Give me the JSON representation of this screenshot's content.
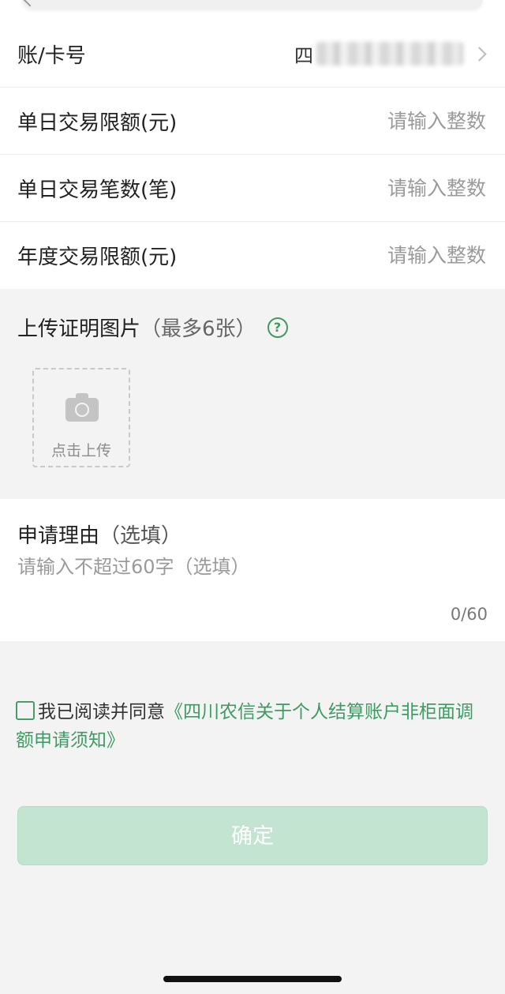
{
  "form": {
    "account": {
      "label": "账/卡号",
      "value_prefix": "四"
    },
    "daily_limit": {
      "label": "单日交易限额(元)",
      "placeholder": "请输入整数"
    },
    "daily_count": {
      "label": "单日交易笔数(笔)",
      "placeholder": "请输入整数"
    },
    "annual_limit": {
      "label": "年度交易限额(元)",
      "placeholder": "请输入整数"
    }
  },
  "upload": {
    "title": "上传证明图片",
    "hint": "（最多6张）",
    "help_icon_text": "?",
    "button_label": "点击上传"
  },
  "reason": {
    "title": "申请理由",
    "hint": "（选填）",
    "placeholder": "请输入不超过60字（选填）",
    "counter": "0/60"
  },
  "agreement": {
    "text": "我已阅读并同意",
    "link": "《四川农信关于个人结算账户非柜面调额申请须知》"
  },
  "confirm_label": "确定",
  "colors": {
    "accent": "#3f9a64",
    "button_disabled": "#c3e4d0",
    "background": "#f3f3f3"
  }
}
